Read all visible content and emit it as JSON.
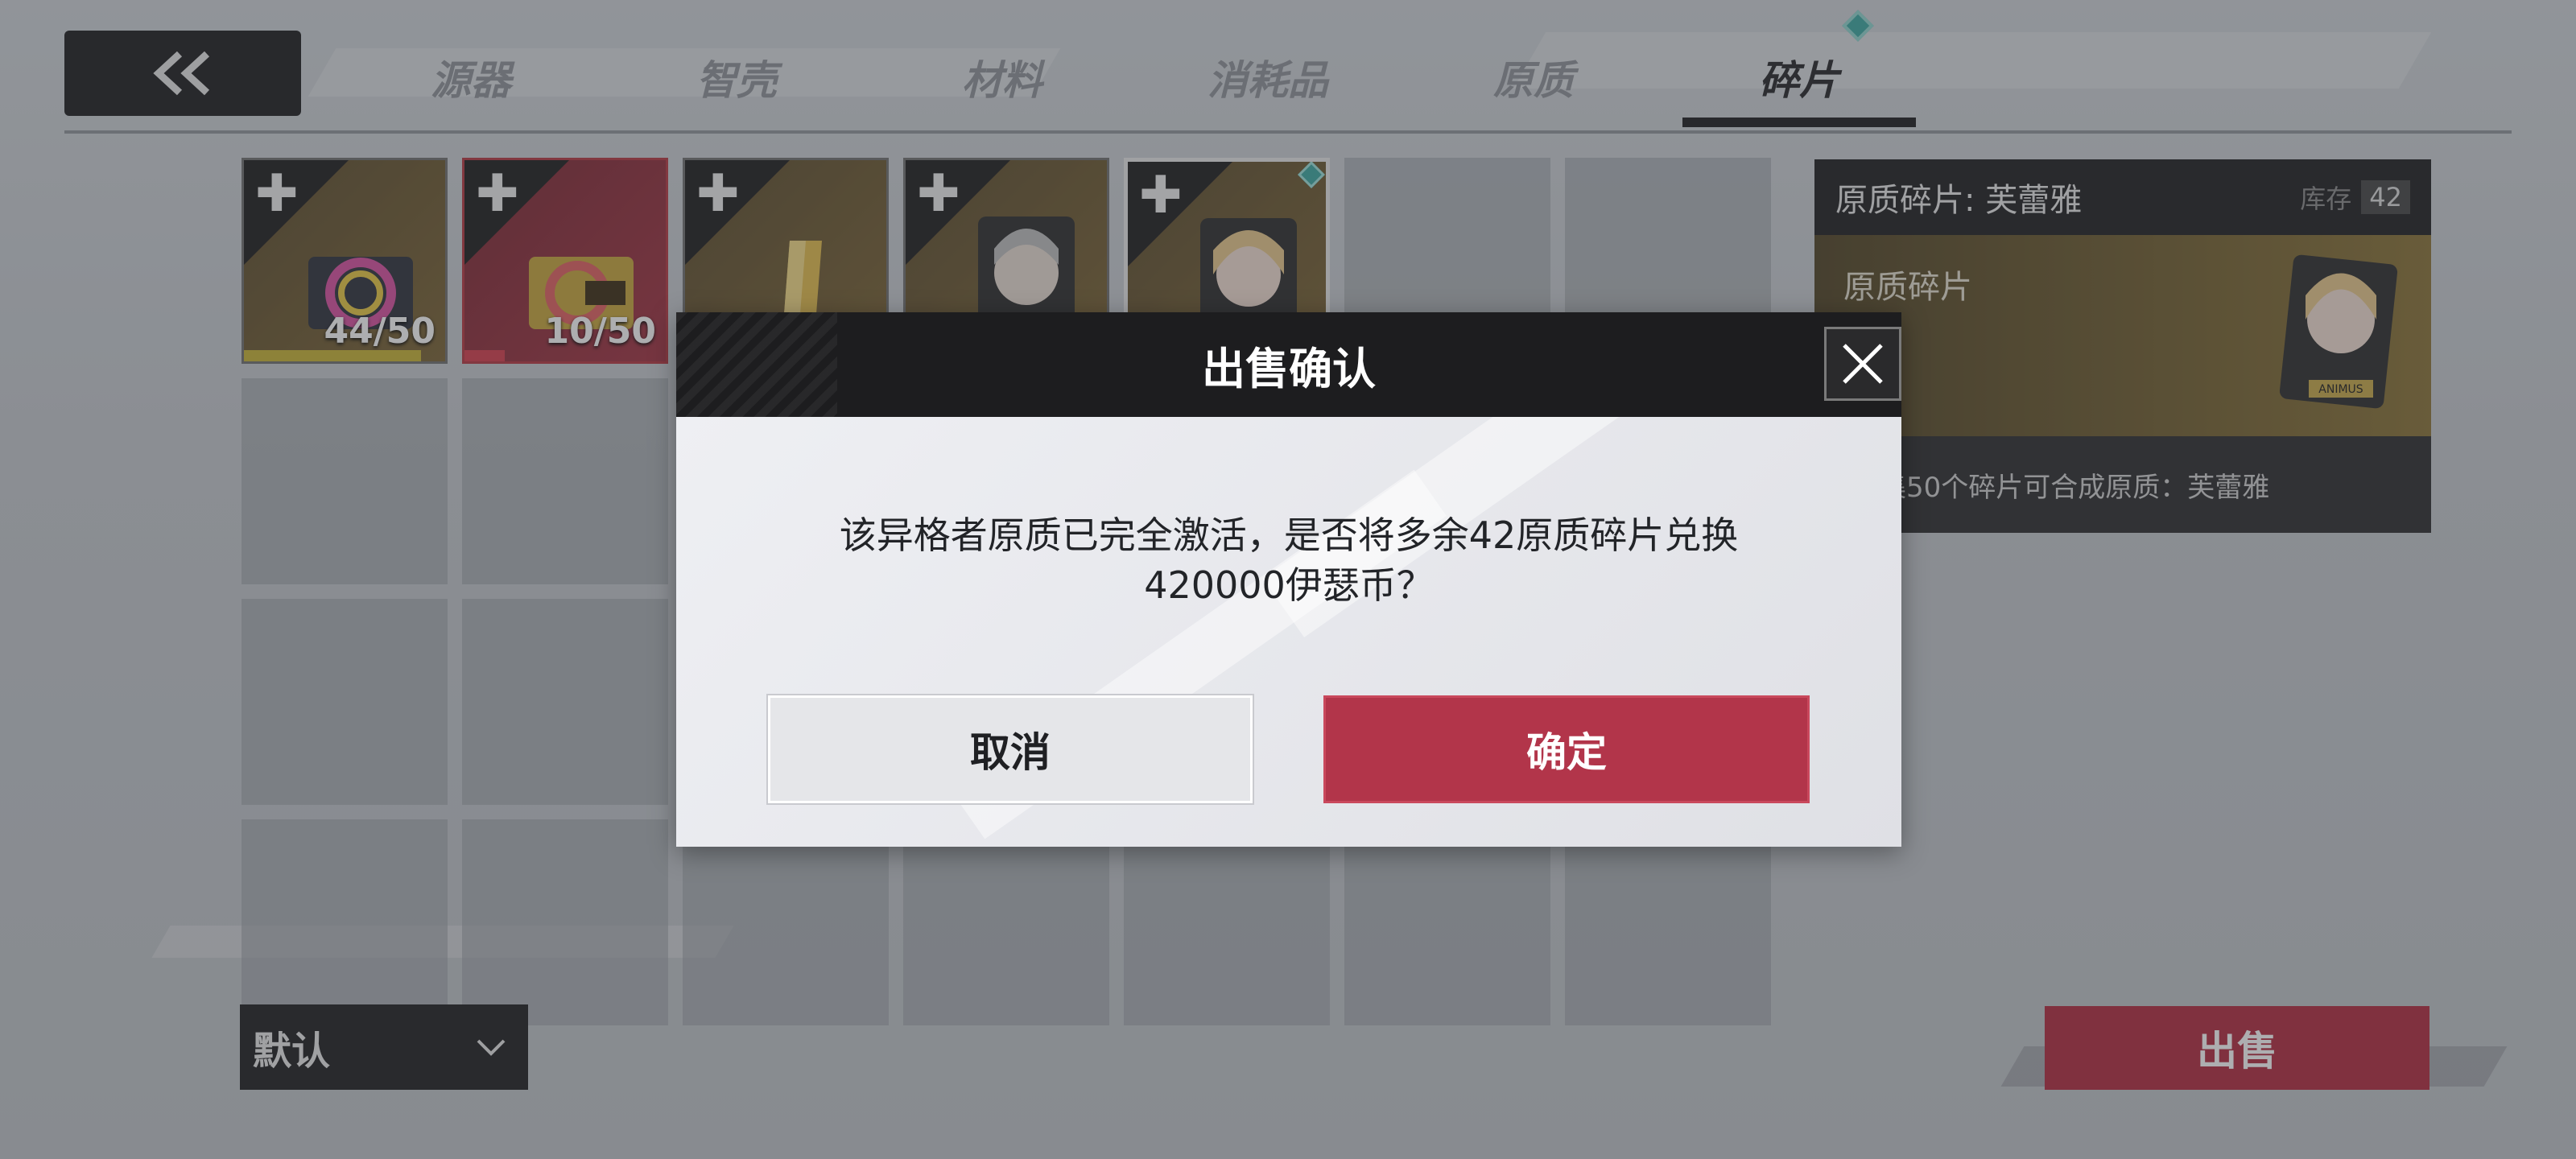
{
  "tabs": [
    {
      "label": "源器",
      "active": false
    },
    {
      "label": "智壳",
      "active": false
    },
    {
      "label": "材料",
      "active": false
    },
    {
      "label": "消耗品",
      "active": false
    },
    {
      "label": "原质",
      "active": false
    },
    {
      "label": "碎片",
      "active": true
    }
  ],
  "icons": {
    "back": "double-chevron-left-icon",
    "puzzle": "puzzle-piece-icon",
    "close": "close-icon",
    "dropdown": "chevron-down-icon"
  },
  "inventory": {
    "items": [
      {
        "count": "44/50",
        "rarity": "gold",
        "progress": 0.88
      },
      {
        "count": "10/50",
        "rarity": "red",
        "progress": 0.2
      },
      {
        "count": "",
        "rarity": "gold"
      },
      {
        "count": "",
        "rarity": "gold"
      },
      {
        "count": "",
        "rarity": "gold",
        "selected": true
      }
    ]
  },
  "detail": {
    "title": "原质碎片: 芙蕾雅",
    "stock_label": "库存",
    "stock_value": "42",
    "card_label": "原质碎片",
    "portrait_tag": "ANIMUS",
    "description": "集50个碎片可合成原质：芙蕾雅"
  },
  "controls": {
    "sort_label": "默认",
    "sell_label": "出售"
  },
  "dialog": {
    "title": "出售确认",
    "message_line1": "该异格者原质已完全激活，是否将多余42原质碎片兑换",
    "message_line2": "420000伊瑟币？",
    "cancel_label": "取消",
    "confirm_label": "确定"
  },
  "colors": {
    "accent_red": "#b2354a",
    "gold_bar": "#c9b433",
    "teal_marker": "#39a7a0"
  }
}
